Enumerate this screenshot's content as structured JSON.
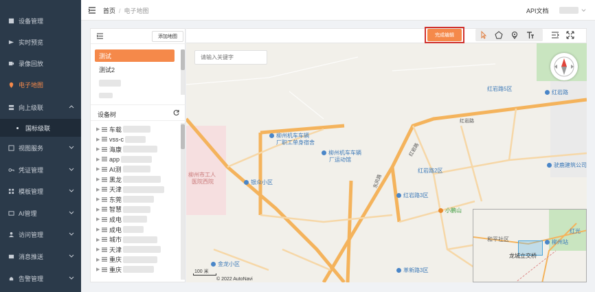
{
  "sidebar": {
    "items": [
      {
        "label": "设备管理",
        "icon": "device-icon"
      },
      {
        "label": "实时预览",
        "icon": "video-icon"
      },
      {
        "label": "录像回放",
        "icon": "playback-icon"
      },
      {
        "label": "电子地图",
        "icon": "map-pin-icon",
        "active": true
      },
      {
        "label": "向上级联",
        "icon": "cascade-icon"
      },
      {
        "label": "视图服务",
        "icon": "view-icon"
      },
      {
        "label": "凭证管理",
        "icon": "key-icon"
      },
      {
        "label": "模板管理",
        "icon": "template-icon"
      },
      {
        "label": "AI管理",
        "icon": "ai-icon"
      },
      {
        "label": "访问管理",
        "icon": "user-icon"
      },
      {
        "label": "消息推送",
        "icon": "message-icon"
      },
      {
        "label": "告警管理",
        "icon": "alarm-icon"
      }
    ],
    "sub_item": "国标级联",
    "active_color": "#f5894a"
  },
  "header": {
    "breadcrumb_home": "首页",
    "breadcrumb_separator": "/",
    "breadcrumb_current": "电子地图",
    "api_doc": "API文档"
  },
  "left_panel": {
    "add_map_label": "添加地图",
    "maps": [
      "测试",
      "测试2"
    ],
    "device_tree_title": "设备树",
    "tree_rows": [
      "车载",
      "vss-c",
      "海康",
      "app",
      "AI测",
      "黑龙",
      "天津",
      "东莞",
      "智慧",
      "成电",
      "成电",
      "城市",
      "天津",
      "重庆",
      "重庆"
    ]
  },
  "map": {
    "finish_label": "完成编辑",
    "search_placeholder": "请输入关键字",
    "scale_label": "100 米",
    "copyright": "© 2022 AutoNavi",
    "pois": {
      "hongyanlu5": "红岩路5区",
      "hongyanlu": "红岩路",
      "hongyanlu2": "红岩路2区",
      "hongyanlu3": "红岩路3区",
      "liuzhou_club_1": "柳州机车车辆",
      "liuzhou_club_2": "厂职工单身宿舍",
      "liuzhou_sport_1": "柳州机车车辆",
      "liuzhou_sport_2": "厂运动馆",
      "yinzhong": "银众小区",
      "hospital_1": "柳州市工人",
      "hospital_2": "医院西院",
      "xiaoyingshan": "小鹏山",
      "poyi": "驶鹿建筑公司",
      "jinlun": "金龙小区",
      "gemin": "革新路3区",
      "dongfeng": "东风路",
      "road_hongyanlu": "红岩路",
      "road_xingfu": "红岩路"
    },
    "minimap": {
      "heping": "和平社区",
      "liuzhou_station": "柳州站",
      "longcheng": "龙城立交桥",
      "hongguang": "红光"
    }
  }
}
